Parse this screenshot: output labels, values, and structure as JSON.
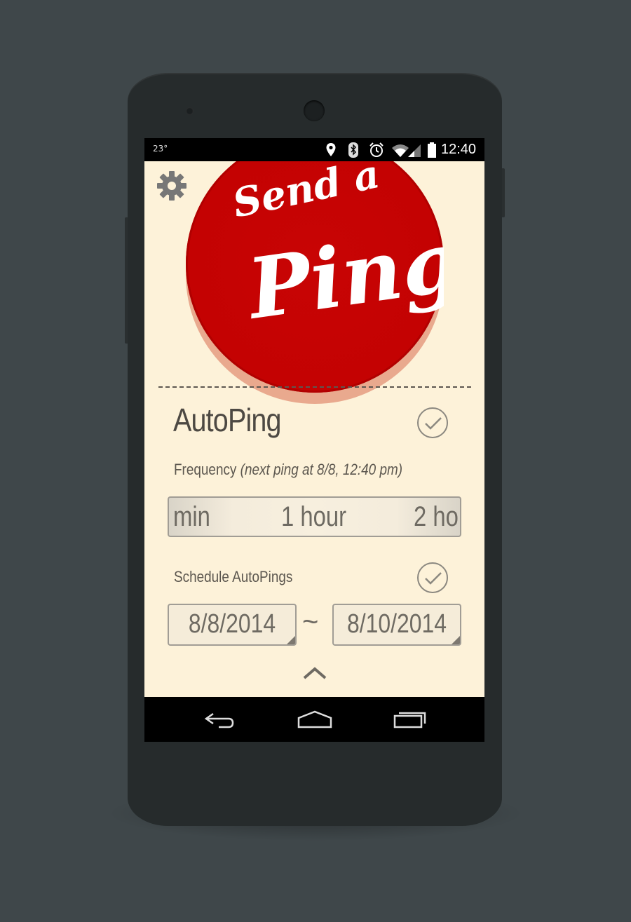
{
  "status_bar": {
    "temperature": "23°",
    "time": "12:40",
    "icons": [
      "location-icon",
      "bluetooth-icon",
      "alarm-icon",
      "wifi-icon",
      "signal-icon",
      "battery-icon"
    ]
  },
  "app": {
    "background_color": "#fdf2d9",
    "settings_icon": "gear-icon",
    "ping_button": {
      "line1": "Send a",
      "line2": "Ping",
      "color": "#c30202"
    },
    "autoping": {
      "title": "AutoPing",
      "enabled": true,
      "frequency_label": "Frequency",
      "frequency_note": "(next ping at 8/8, 12:40 pm)",
      "frequency_options_visible": [
        "min",
        "1 hour",
        "2 ho"
      ],
      "selected_frequency": "1 hour"
    },
    "schedule": {
      "label": "Schedule AutoPings",
      "enabled": true,
      "start_date": "8/8/2014",
      "separator": "~",
      "end_date": "8/10/2014"
    },
    "collapse_icon": "chevron-up-icon"
  },
  "nav_bar": {
    "icons": [
      "back-icon",
      "home-icon",
      "recent-apps-icon"
    ]
  }
}
